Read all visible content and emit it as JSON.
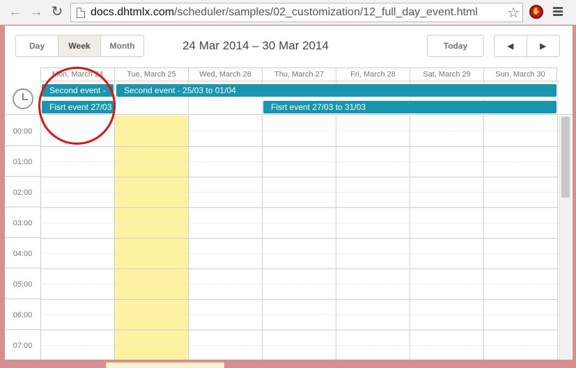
{
  "browser": {
    "url_host": "docs.dhtmlx.com",
    "url_path": "/scheduler/samples/02_customization/12_full_day_event.html",
    "stop_label": "✋"
  },
  "scheduler": {
    "tabs": [
      {
        "label": "Day",
        "active": false
      },
      {
        "label": "Week",
        "active": true
      },
      {
        "label": "Month",
        "active": false
      }
    ],
    "date_range": "24 Mar 2014 – 30 Mar 2014",
    "today_label": "Today",
    "prev_label": "◀",
    "next_label": "▶",
    "days": [
      "Mon, March 24",
      "Tue, March 25",
      "Wed, March 26",
      "Thu, March 27",
      "Fri, March 28",
      "Sat, March 29",
      "Sun, March 30"
    ],
    "allday_events": [
      {
        "text": "Second event -",
        "row": 0
      },
      {
        "text": "Second event - 25/03 to 01/04",
        "row": 0
      },
      {
        "text": "Fisrt event 27/03",
        "row": 1
      },
      {
        "text": "Fisrt event 27/03 to 31/03",
        "row": 1
      }
    ],
    "hours": [
      "00:00",
      "01:00",
      "02:00",
      "03:00",
      "04:00",
      "05:00",
      "06:00",
      "07:00"
    ],
    "highlight_color": "#fff3a1",
    "event_color": "#1796b0"
  }
}
